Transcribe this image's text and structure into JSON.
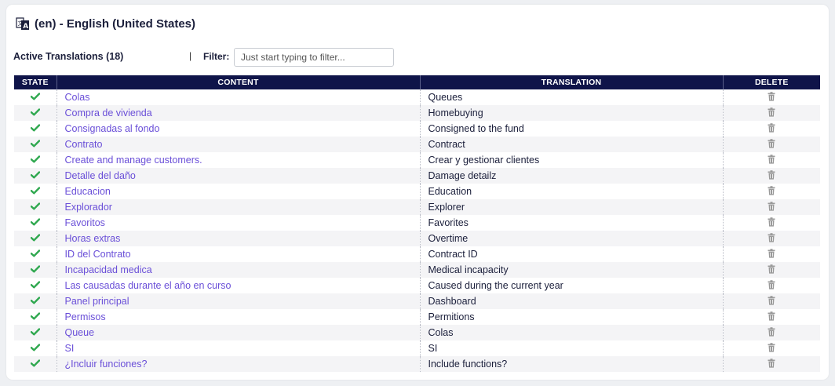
{
  "header": {
    "title": "(en) - English (United States)",
    "icon": "translate-icon"
  },
  "toolbar": {
    "active_label": "Active Translations (18)",
    "separator": "|",
    "filter_label": "Filter:",
    "filter_placeholder": "Just start typing to filter...",
    "filter_value": ""
  },
  "table": {
    "columns": [
      "STATE",
      "CONTENT",
      "TRANSLATION",
      "DELETE"
    ],
    "rows": [
      {
        "content": "Colas",
        "translation": "Queues"
      },
      {
        "content": "Compra de vivienda",
        "translation": "Homebuying"
      },
      {
        "content": "Consignadas al fondo",
        "translation": "Consigned to the fund"
      },
      {
        "content": "Contrato",
        "translation": "Contract"
      },
      {
        "content": "Create and manage customers.",
        "translation": "Crear y gestionar clientes"
      },
      {
        "content": "Detalle del daño",
        "translation": "Damage detailz"
      },
      {
        "content": "Educacion",
        "translation": "Education"
      },
      {
        "content": "Explorador",
        "translation": "Explorer"
      },
      {
        "content": "Favoritos",
        "translation": "Favorites"
      },
      {
        "content": "Horas extras",
        "translation": "Overtime"
      },
      {
        "content": "ID del Contrato",
        "translation": "Contract ID"
      },
      {
        "content": "Incapacidad medica",
        "translation": "Medical incapacity"
      },
      {
        "content": "Las causadas durante el año en curso",
        "translation": "Caused during the current year"
      },
      {
        "content": "Panel principal",
        "translation": "Dashboard"
      },
      {
        "content": "Permisos",
        "translation": "Permitions"
      },
      {
        "content": "Queue",
        "translation": "Colas"
      },
      {
        "content": "SI",
        "translation": "SI"
      },
      {
        "content": "¿Incluir funciones?",
        "translation": "Include functions?"
      }
    ]
  },
  "colors": {
    "header_bg": "#0f1449",
    "link": "#6a4fd8",
    "check": "#2fa84f",
    "trash": "#9a9a9a"
  }
}
